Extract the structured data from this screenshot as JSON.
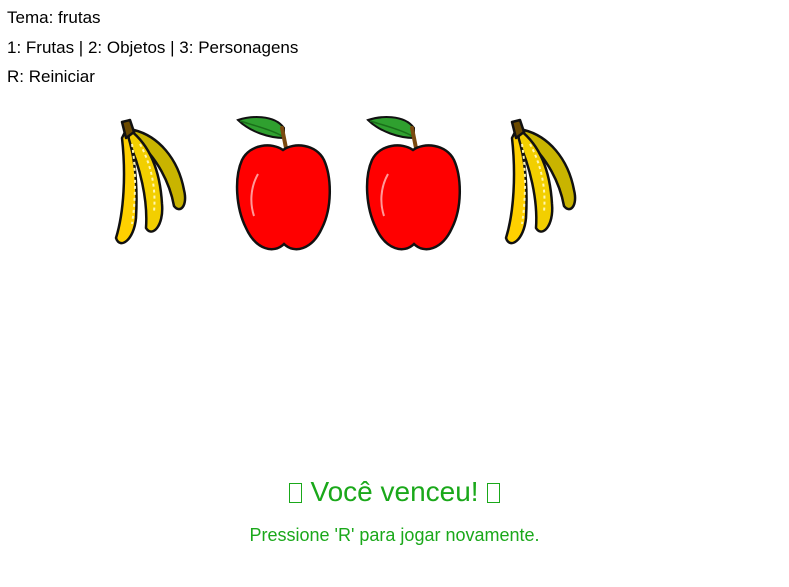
{
  "hud": {
    "theme_line": "Tema: frutas",
    "themes_line": "1: Frutas | 2: Objetos | 3: Personagens",
    "restart_line": "R: Reiniciar"
  },
  "cards": [
    {
      "fruit": "banana",
      "icon": "banana-icon"
    },
    {
      "fruit": "apple",
      "icon": "apple-icon"
    },
    {
      "fruit": "apple",
      "icon": "apple-icon"
    },
    {
      "fruit": "banana",
      "icon": "banana-icon"
    }
  ],
  "result": {
    "title": "Você venceu!",
    "subtitle": "Pressione 'R' para jogar novamente.",
    "color": "#1aa81a"
  }
}
